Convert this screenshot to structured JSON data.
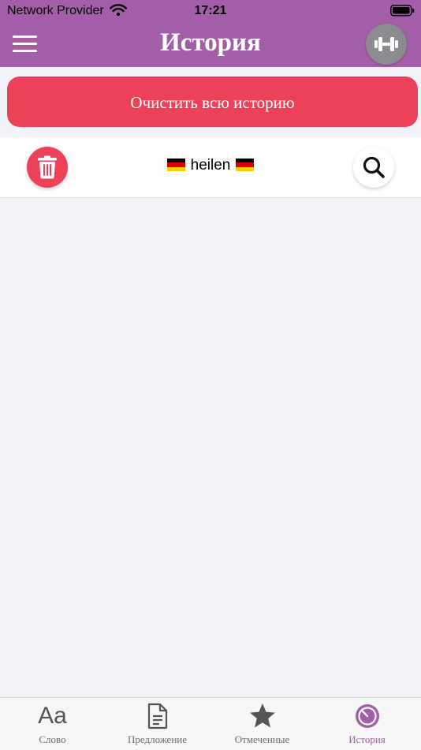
{
  "status": {
    "carrier": "Network Provider",
    "time": "17:21"
  },
  "header": {
    "title": "История"
  },
  "actions": {
    "clear_history": "Очистить всю историю"
  },
  "history": [
    {
      "word": "heilen",
      "language": "de"
    }
  ],
  "tabs": [
    {
      "label": "Слово",
      "icon": "text-aa-icon",
      "active": false
    },
    {
      "label": "Предложение",
      "icon": "document-icon",
      "active": false
    },
    {
      "label": "Отмеченные",
      "icon": "star-icon",
      "active": false
    },
    {
      "label": "История",
      "icon": "history-clock-icon",
      "active": true
    }
  ],
  "colors": {
    "primary": "#a25fa8",
    "danger": "#ec4159",
    "background": "#f2f3f8"
  }
}
